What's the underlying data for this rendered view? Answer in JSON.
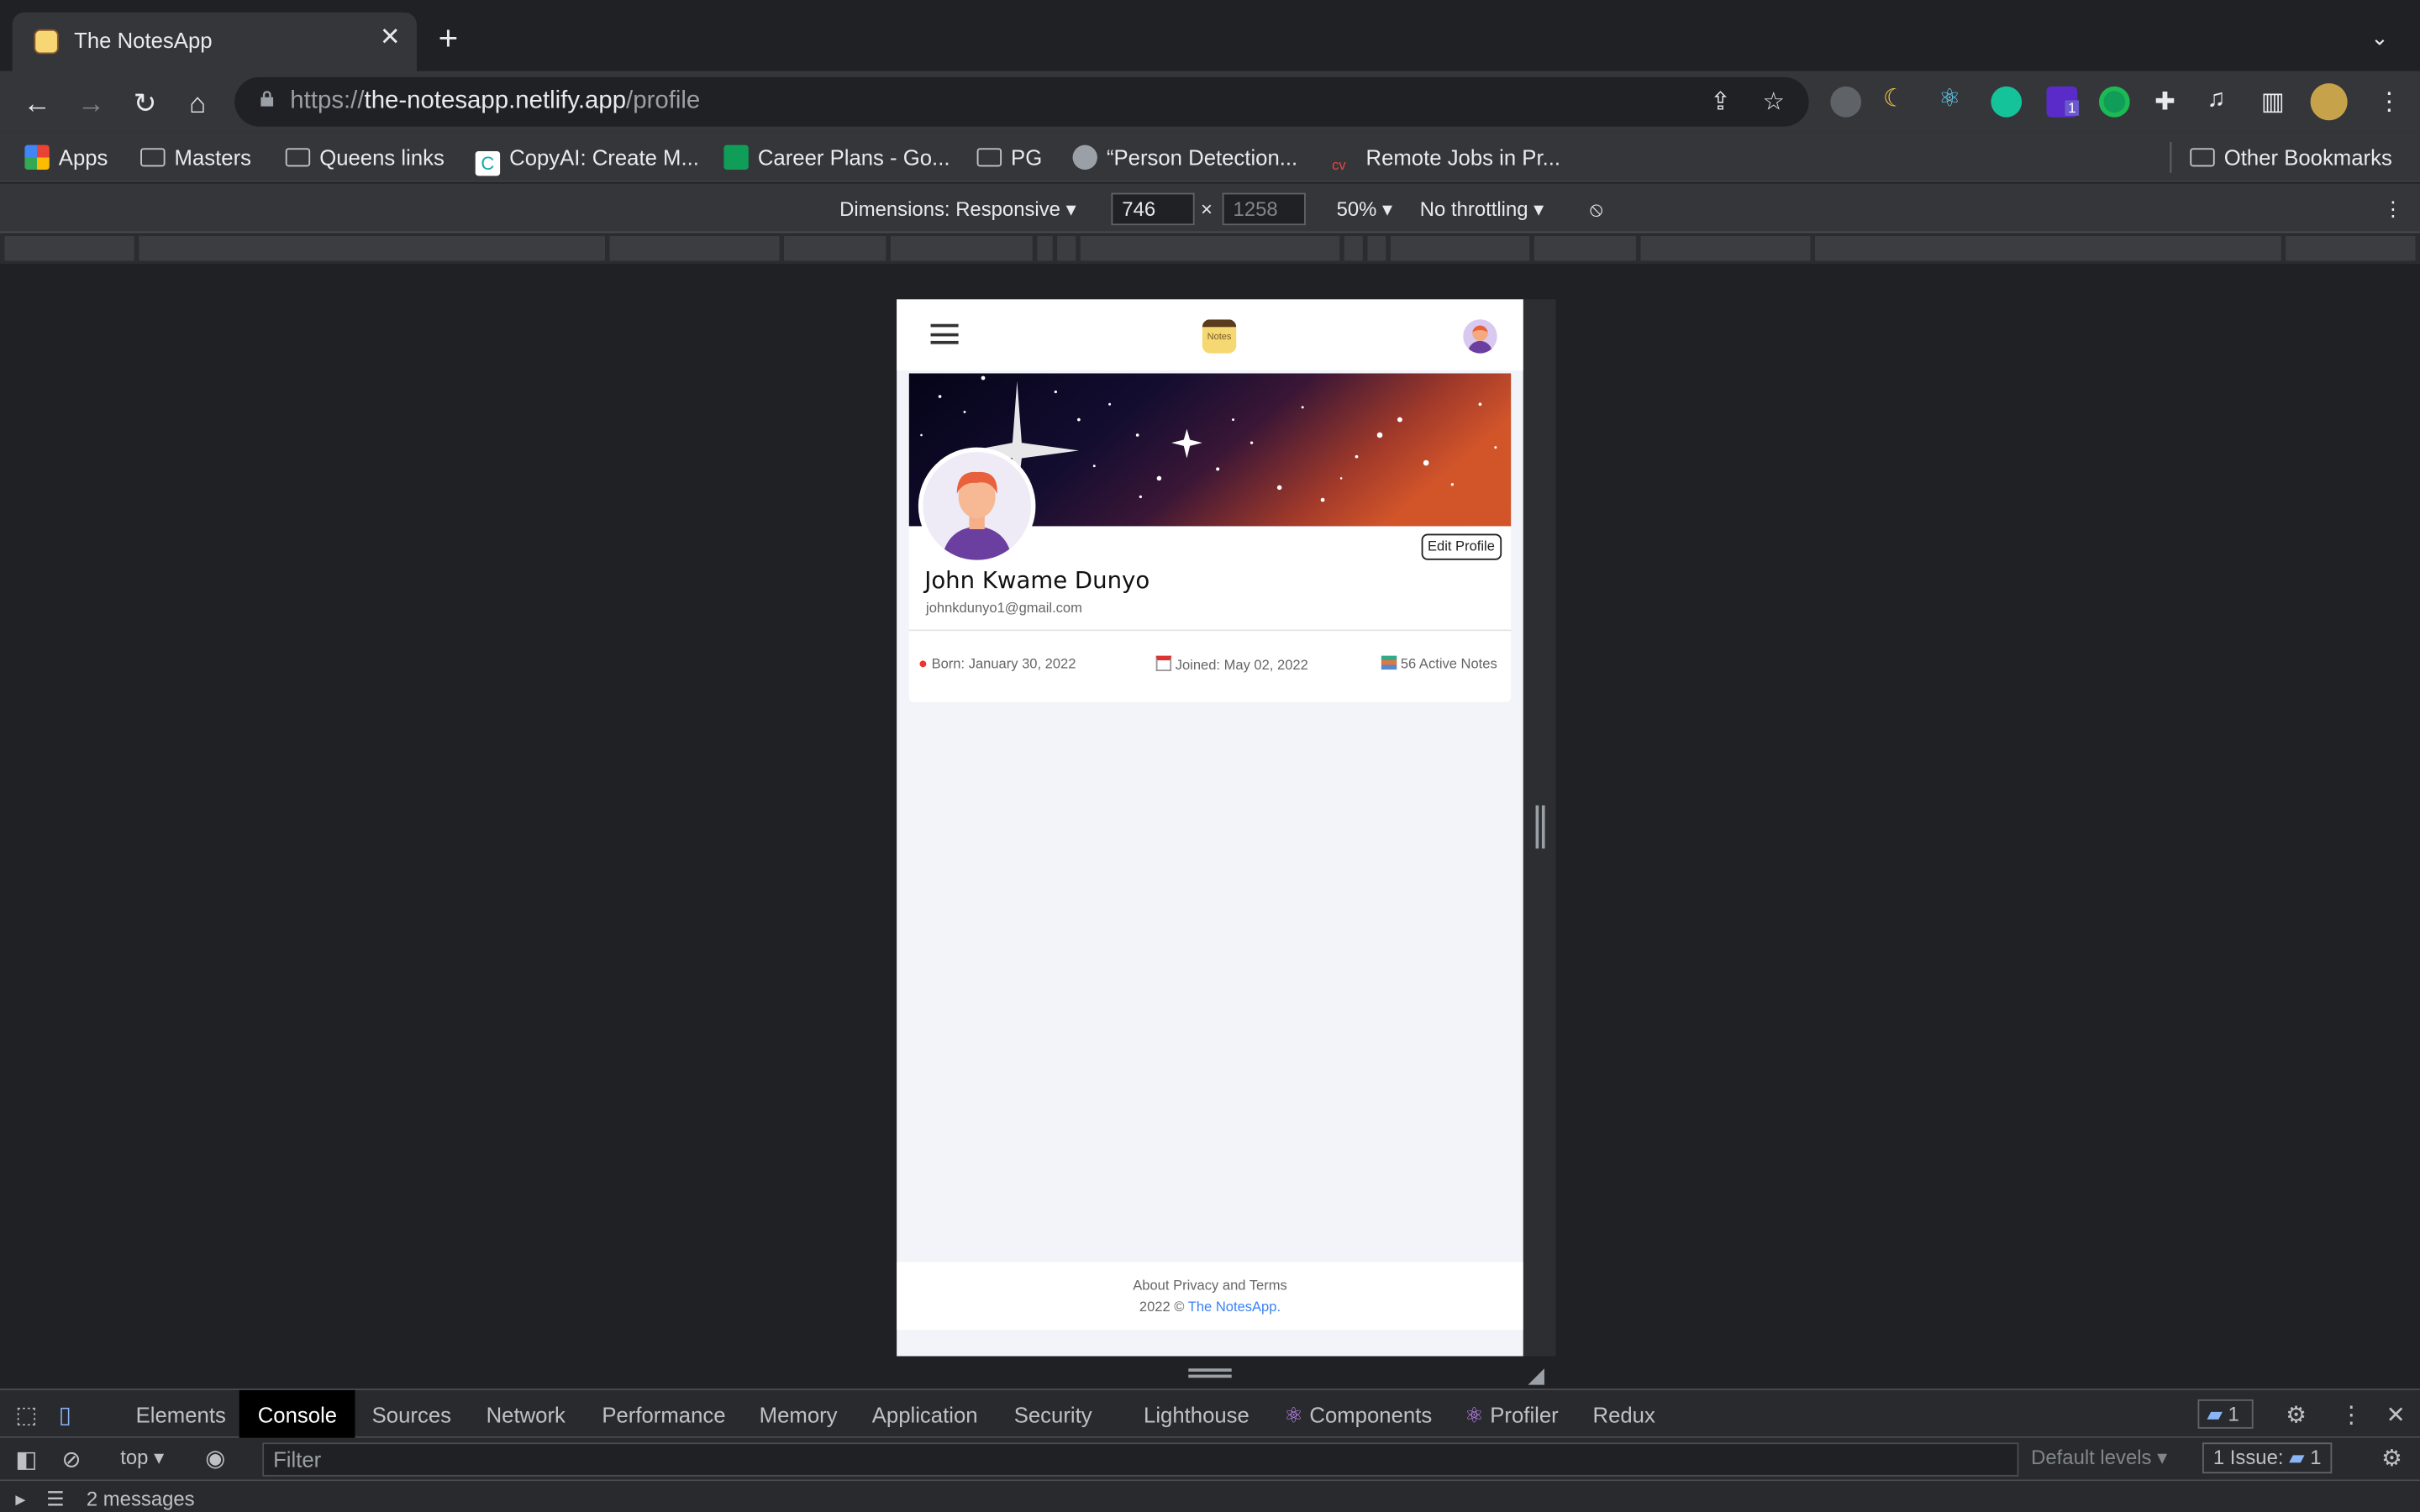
{
  "browser": {
    "tab_title": "The NotesApp",
    "url_scheme": "https://",
    "url_host": "the-notesapp.netlify.app",
    "url_path": "/profile",
    "bookmarks": [
      {
        "label": "Apps",
        "icon": "apps-grid-icon"
      },
      {
        "label": "Masters",
        "icon": "folder-icon"
      },
      {
        "label": "Queens links",
        "icon": "folder-icon"
      },
      {
        "label": "CopyAI: Create M...",
        "icon": "copyai-icon"
      },
      {
        "label": "Career Plans - Go...",
        "icon": "sheets-icon"
      },
      {
        "label": "PG",
        "icon": "folder-icon"
      },
      {
        "label": "“Person Detection...",
        "icon": "globe-icon"
      },
      {
        "label": "Remote Jobs in Pr...",
        "icon": "cv-icon"
      },
      {
        "label": "Other Bookmarks",
        "icon": "folder-icon"
      }
    ],
    "extension_badge": "1"
  },
  "device_toolbar": {
    "dimensions_label": "Dimensions: Responsive",
    "width": "746",
    "height": "1258",
    "zoom": "50%",
    "throttling": "No throttling"
  },
  "app": {
    "logo_text": "Notes",
    "profile": {
      "name": "John Kwame Dunyo",
      "email": "johnkdunyo1@gmail.com",
      "edit_label": "Edit Profile",
      "born": "Born: January 30, 2022",
      "joined": "Joined: May 02, 2022",
      "notes": "56 Active Notes"
    },
    "footer": {
      "about": "About",
      "privacy": "Privacy and Terms",
      "copyright": "2022 ©",
      "brand": "The NotesApp."
    }
  },
  "devtools": {
    "tabs": [
      "Elements",
      "Console",
      "Sources",
      "Network",
      "Performance",
      "Memory",
      "Application",
      "Security",
      "Lighthouse",
      "Components",
      "Profiler",
      "Redux"
    ],
    "selected_tab": "Console",
    "message_count": "1",
    "context": "top",
    "filter_placeholder": "Filter",
    "levels": "Default levels",
    "issues_label": "1 Issue:",
    "issues_count": "1",
    "messages": "2 messages"
  },
  "colors": {
    "chrome_dark": "#202124",
    "chrome_toolbar": "#35363a",
    "link_blue": "#3b82f6"
  }
}
